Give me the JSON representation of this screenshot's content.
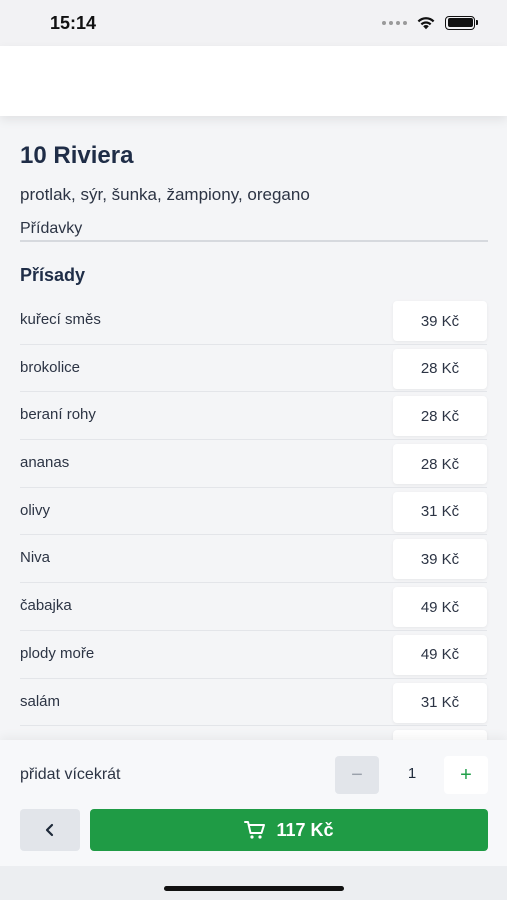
{
  "status_bar": {
    "time": "15:14",
    "icons": [
      "signal-dots-icon",
      "wifi-icon",
      "battery-icon"
    ]
  },
  "item": {
    "title": "10 Riviera",
    "description": "protlak, sýr, šunka, žampiony, oregano"
  },
  "extras_tab": {
    "label": "Přídavky"
  },
  "ingredients": {
    "title": "Přísady",
    "items": [
      {
        "name": "kuřecí směs",
        "price": "39 Kč"
      },
      {
        "name": "brokolice",
        "price": "28 Kč"
      },
      {
        "name": "beraní rohy",
        "price": "28 Kč"
      },
      {
        "name": "ananas",
        "price": "28 Kč"
      },
      {
        "name": "olivy",
        "price": "31 Kč"
      },
      {
        "name": "Niva",
        "price": "39 Kč"
      },
      {
        "name": "čabajka",
        "price": "49 Kč"
      },
      {
        "name": "plody moře",
        "price": "49 Kč"
      },
      {
        "name": "salám",
        "price": "31 Kč"
      }
    ]
  },
  "quantity": {
    "label": "přidat vícekrát",
    "minus_label": "−",
    "value": "1",
    "plus_label": "+"
  },
  "actions": {
    "back_icon": "chevron-left-icon",
    "cart_icon": "cart-icon",
    "cart_total": "117 Kč"
  },
  "colors": {
    "accent_green": "#1f9b45",
    "title_navy": "#1f2d47"
  }
}
